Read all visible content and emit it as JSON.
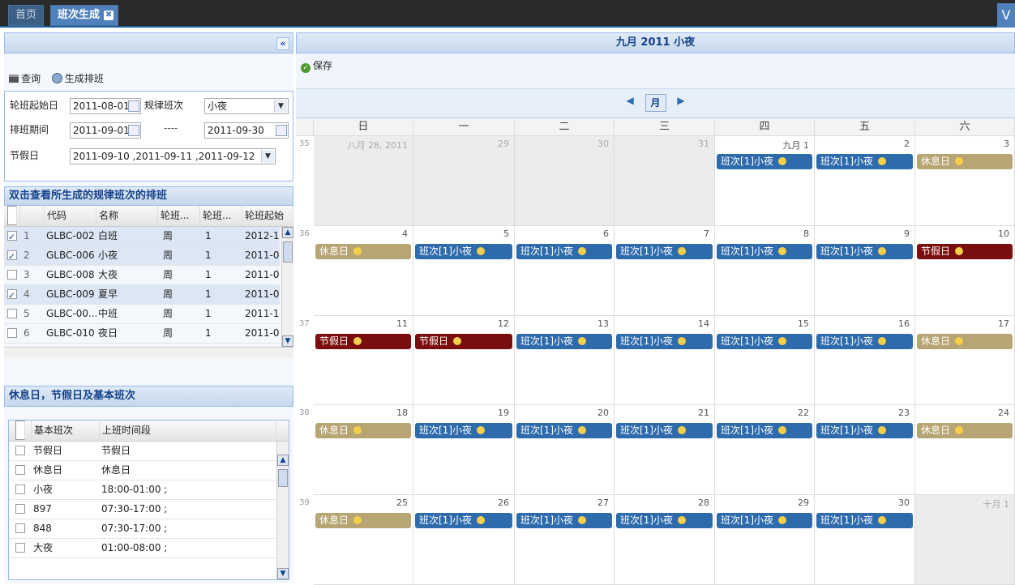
{
  "tabs": {
    "home": "首页",
    "active": "班次生成",
    "close": "✖",
    "right": "V"
  },
  "left": {
    "toolbar": {
      "query": "查询",
      "generate": "生成排班"
    },
    "form": {
      "start_label": "轮班起始日",
      "start_value": "2011-08-01",
      "rule_label": "规律班次",
      "rule_value": "小夜",
      "period_label": "排班期间",
      "period_from": "2011-09-01",
      "period_sep": "----",
      "period_to": "2011-09-30",
      "holiday_label": "节假日",
      "holiday_value": "2011-09-10 ,2011-09-11 ,2011-09-12"
    },
    "grid1": {
      "title": "双击查看所生成的规律班次的排班",
      "headers": [
        "代码",
        "名称",
        "轮班...",
        "轮班...",
        "轮班起始"
      ],
      "rows": [
        {
          "n": "1",
          "code": "GLBC-002",
          "name": "白班",
          "c": "周",
          "k": "1",
          "start": "2012-1",
          "checked": true
        },
        {
          "n": "2",
          "code": "GLBC-006",
          "name": "小夜",
          "c": "周",
          "k": "1",
          "start": "2011-0",
          "checked": true
        },
        {
          "n": "3",
          "code": "GLBC-008",
          "name": "大夜",
          "c": "周",
          "k": "1",
          "start": "2011-0",
          "checked": false
        },
        {
          "n": "4",
          "code": "GLBC-009",
          "name": "夏早",
          "c": "周",
          "k": "1",
          "start": "2011-0",
          "checked": true
        },
        {
          "n": "5",
          "code": "GLBC-00...",
          "name": "中班",
          "c": "周",
          "k": "1",
          "start": "2011-1",
          "checked": false
        },
        {
          "n": "6",
          "code": "GLBC-010",
          "name": "夜日",
          "c": "周",
          "k": "1",
          "start": "2011-0",
          "checked": false
        }
      ]
    },
    "grid2": {
      "title": "休息日，节假日及基本班次",
      "headers": [
        "基本班次",
        "上班时间段"
      ],
      "rows": [
        {
          "name": "节假日",
          "time": "节假日"
        },
        {
          "name": "休息日",
          "time": "休息日"
        },
        {
          "name": "小夜",
          "time": "18:00-01:00 ;"
        },
        {
          "name": "897",
          "time": "07:30-17:00 ;"
        },
        {
          "name": "848",
          "time": "07:30-17:00 ;"
        },
        {
          "name": "大夜",
          "time": "01:00-08:00 ;"
        }
      ]
    }
  },
  "right": {
    "title": "九月 2011 小夜",
    "save": "保存",
    "view": "月",
    "dows": [
      "日",
      "一",
      "二",
      "三",
      "四",
      "五",
      "六"
    ],
    "weeks": [
      {
        "wk": "35",
        "days": [
          {
            "d": "八月 28, 2011",
            "other": true
          },
          {
            "d": "29",
            "other": true
          },
          {
            "d": "30",
            "other": true
          },
          {
            "d": "31",
            "other": true
          },
          {
            "d": "九月 1",
            "ev": "班次[1]小夜",
            "t": "shift"
          },
          {
            "d": "2",
            "ev": "班次[1]小夜",
            "t": "shift"
          },
          {
            "d": "3",
            "ev": "休息日",
            "t": "rest"
          }
        ]
      },
      {
        "wk": "36",
        "days": [
          {
            "d": "4",
            "ev": "休息日",
            "t": "rest"
          },
          {
            "d": "5",
            "ev": "班次[1]小夜",
            "t": "shift"
          },
          {
            "d": "6",
            "ev": "班次[1]小夜",
            "t": "shift"
          },
          {
            "d": "7",
            "ev": "班次[1]小夜",
            "t": "shift"
          },
          {
            "d": "8",
            "ev": "班次[1]小夜",
            "t": "shift"
          },
          {
            "d": "9",
            "ev": "班次[1]小夜",
            "t": "shift"
          },
          {
            "d": "10",
            "ev": "节假日",
            "t": "holiday"
          }
        ]
      },
      {
        "wk": "37",
        "days": [
          {
            "d": "11",
            "ev": "节假日",
            "t": "holiday"
          },
          {
            "d": "12",
            "ev": "节假日",
            "t": "holiday"
          },
          {
            "d": "13",
            "ev": "班次[1]小夜",
            "t": "shift"
          },
          {
            "d": "14",
            "ev": "班次[1]小夜",
            "t": "shift"
          },
          {
            "d": "15",
            "ev": "班次[1]小夜",
            "t": "shift"
          },
          {
            "d": "16",
            "ev": "班次[1]小夜",
            "t": "shift"
          },
          {
            "d": "17",
            "ev": "休息日",
            "t": "rest"
          }
        ]
      },
      {
        "wk": "38",
        "days": [
          {
            "d": "18",
            "ev": "休息日",
            "t": "rest"
          },
          {
            "d": "19",
            "ev": "班次[1]小夜",
            "t": "shift"
          },
          {
            "d": "20",
            "ev": "班次[1]小夜",
            "t": "shift"
          },
          {
            "d": "21",
            "ev": "班次[1]小夜",
            "t": "shift"
          },
          {
            "d": "22",
            "ev": "班次[1]小夜",
            "t": "shift"
          },
          {
            "d": "23",
            "ev": "班次[1]小夜",
            "t": "shift"
          },
          {
            "d": "24",
            "ev": "休息日",
            "t": "rest"
          }
        ]
      },
      {
        "wk": "39",
        "days": [
          {
            "d": "25",
            "ev": "休息日",
            "t": "rest"
          },
          {
            "d": "26",
            "ev": "班次[1]小夜",
            "t": "shift"
          },
          {
            "d": "27",
            "ev": "班次[1]小夜",
            "t": "shift"
          },
          {
            "d": "28",
            "ev": "班次[1]小夜",
            "t": "shift"
          },
          {
            "d": "29",
            "ev": "班次[1]小夜",
            "t": "shift"
          },
          {
            "d": "30",
            "ev": "班次[1]小夜",
            "t": "shift"
          },
          {
            "d": "十月 1",
            "other": true
          }
        ]
      }
    ]
  }
}
